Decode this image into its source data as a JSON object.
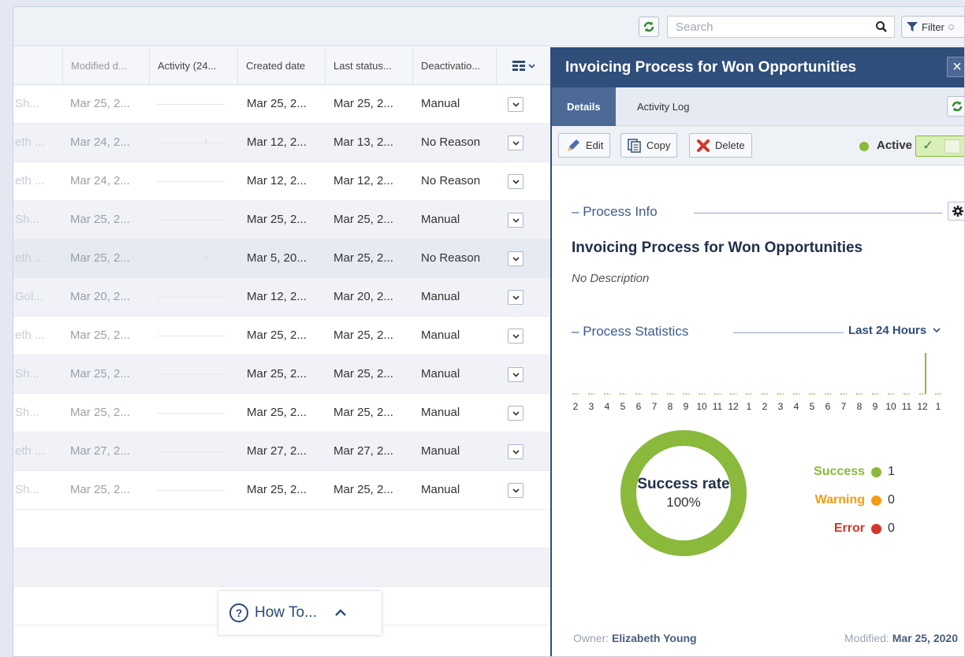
{
  "toolbar": {
    "search_placeholder": "Search",
    "filter_label": "Filter"
  },
  "grid": {
    "columns": [
      "Modified d...",
      "Activity (24...",
      "Created date",
      "Last status...",
      "Deactivatio..."
    ],
    "rows": [
      {
        "name": "Sh...",
        "modified": "Mar 25, 2...",
        "created": "Mar 25, 2...",
        "last_status": "Mar 25, 2...",
        "deactivation": "Manual"
      },
      {
        "name": "eth ...",
        "modified": "Mar 24, 2...",
        "created": "Mar 12, 2...",
        "last_status": "Mar 13, 2...",
        "deactivation": "No Reason"
      },
      {
        "name": "eth ...",
        "modified": "Mar 24, 2...",
        "created": "Mar 12, 2...",
        "last_status": "Mar 12, 2...",
        "deactivation": "No Reason"
      },
      {
        "name": "Sh...",
        "modified": "Mar 25, 2...",
        "created": "Mar 25, 2...",
        "last_status": "Mar 25, 2...",
        "deactivation": "Manual"
      },
      {
        "name": "eth ...",
        "modified": "Mar 25, 2...",
        "created": "Mar 5, 20...",
        "last_status": "Mar 25, 2...",
        "deactivation": "No Reason"
      },
      {
        "name": "Gol...",
        "modified": "Mar 20, 2...",
        "created": "Mar 12, 2...",
        "last_status": "Mar 20, 2...",
        "deactivation": "Manual"
      },
      {
        "name": "eth ...",
        "modified": "Mar 25, 2...",
        "created": "Mar 25, 2...",
        "last_status": "Mar 25, 2...",
        "deactivation": "Manual"
      },
      {
        "name": "Sh...",
        "modified": "Mar 25, 2...",
        "created": "Mar 25, 2...",
        "last_status": "Mar 25, 2...",
        "deactivation": "Manual"
      },
      {
        "name": "Sh...",
        "modified": "Mar 25, 2...",
        "created": "Mar 25, 2...",
        "last_status": "Mar 25, 2...",
        "deactivation": "Manual"
      },
      {
        "name": "eth ...",
        "modified": "Mar 27, 2...",
        "created": "Mar 27, 2...",
        "last_status": "Mar 27, 2...",
        "deactivation": "Manual"
      },
      {
        "name": "Sh...",
        "modified": "Mar 25, 2...",
        "created": "Mar 25, 2...",
        "last_status": "Mar 25, 2...",
        "deactivation": "Manual"
      }
    ],
    "selected_row": 4
  },
  "howto": {
    "label": "How To..."
  },
  "panel": {
    "title": "Invoicing Process for Won Opportunities",
    "tabs": [
      "Details",
      "Activity Log"
    ],
    "actions": {
      "edit": "Edit",
      "copy": "Copy",
      "delete": "Delete"
    },
    "status": "Active",
    "process_info_heading": "Process Info",
    "process_name": "Invoicing Process for Won Opportunities",
    "description": "No Description",
    "statistics_heading": "Process Statistics",
    "range": "Last 24 Hours",
    "hour_labels": [
      "2",
      "3",
      "4",
      "5",
      "6",
      "7",
      "8",
      "9",
      "10",
      "11",
      "12",
      "1",
      "2",
      "3",
      "4",
      "5",
      "6",
      "7",
      "8",
      "9",
      "10",
      "11",
      "12",
      "1"
    ],
    "hourly_success": [
      0,
      0,
      0,
      0,
      0,
      0,
      0,
      0,
      0,
      0,
      0,
      0,
      0,
      0,
      0,
      0,
      0,
      0,
      0,
      0,
      0,
      0,
      1,
      0
    ],
    "donut_title": "Success rate",
    "donut_value": "100%",
    "success_rate": 1.0,
    "legend": [
      {
        "label": "Success",
        "count": "1",
        "color": "#8ab93b"
      },
      {
        "label": "Warning",
        "count": "0",
        "color": "#f39c12"
      },
      {
        "label": "Error",
        "count": "0",
        "color": "#d0392b"
      }
    ],
    "owner_label": "Owner:",
    "owner": "Elizabeth Young",
    "modified_label": "Modified:",
    "modified": "Mar 25, 2020"
  }
}
